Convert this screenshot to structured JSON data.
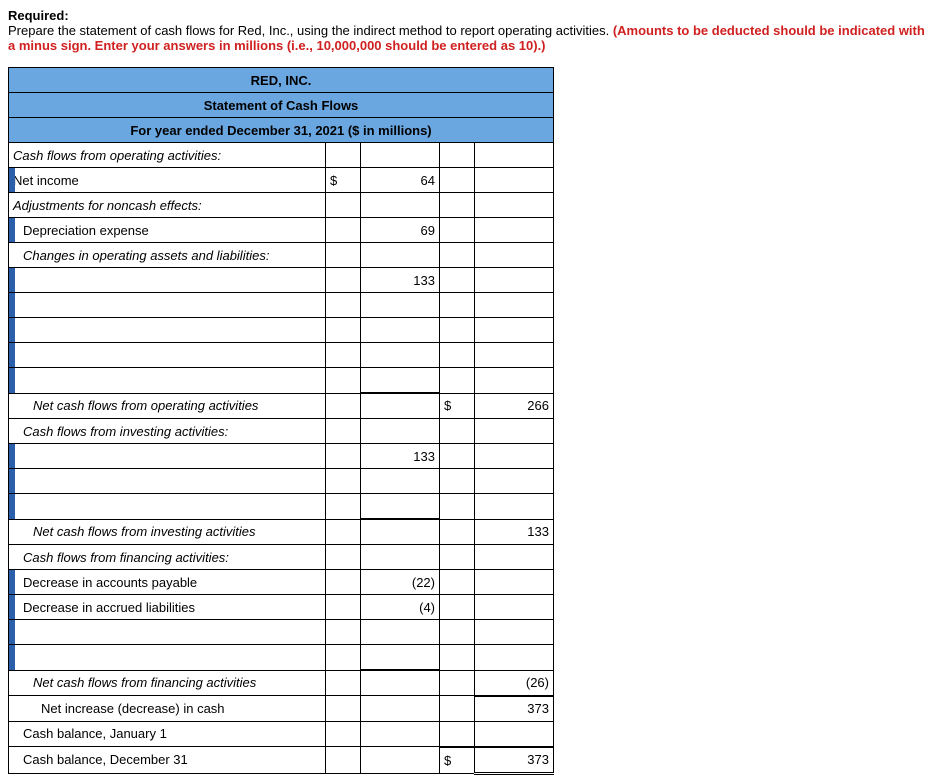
{
  "required": {
    "title": "Required:",
    "text_plain": "Prepare the statement of cash flows for Red, Inc., using the indirect method to report operating activities. ",
    "text_red": "(Amounts to be deducted should be indicated with a minus sign. Enter your answers in millions (i.e., 10,000,000 should be entered as 10).)"
  },
  "headers": {
    "company": "RED, INC.",
    "statement": "Statement of Cash Flows",
    "period": "For year ended December 31, 2021 ($ in millions)"
  },
  "rows": {
    "op_header": "Cash flows from operating activities:",
    "net_income": "Net income",
    "net_income_sym": "$",
    "net_income_val": "64",
    "adj_noncash": "Adjustments for noncash effects:",
    "dep_exp": "Depreciation expense",
    "dep_exp_val": "69",
    "changes_label": "Changes in operating assets and liabilities:",
    "change_val_133": "133",
    "net_op": "Net cash flows from operating activities",
    "net_op_sym": "$",
    "net_op_val": "266",
    "inv_header": "Cash flows from investing activities:",
    "inv_val_133": "133",
    "net_inv": "Net cash flows from investing activities",
    "net_inv_val": "133",
    "fin_header": "Cash flows from financing activities:",
    "dec_ap": "Decrease in accounts payable",
    "dec_ap_val": "(22)",
    "dec_al": "Decrease in accrued liabilities",
    "dec_al_val": "(4)",
    "net_fin": "Net cash flows from financing activities",
    "net_fin_val": "(26)",
    "net_change": "Net increase (decrease) in cash",
    "net_change_val": "373",
    "cash_beg": "Cash balance, January 1",
    "cash_end": "Cash balance, December 31",
    "cash_end_sym": "$",
    "cash_end_val": "373"
  }
}
